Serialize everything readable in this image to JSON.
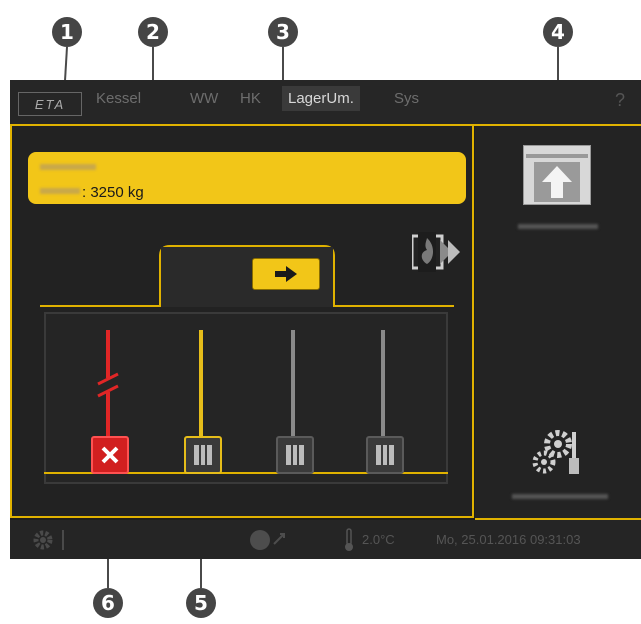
{
  "callouts": [
    {
      "num": "1"
    },
    {
      "num": "2"
    },
    {
      "num": "3"
    },
    {
      "num": "4"
    },
    {
      "num": "5"
    },
    {
      "num": "6"
    }
  ],
  "tabs": [
    {
      "label": "Kessel"
    },
    {
      "label": "WW"
    },
    {
      "label": "HK"
    },
    {
      "label": "LagerUm."
    },
    {
      "label": "Sys"
    }
  ],
  "help_label": "?",
  "logo_text": "ETA",
  "info": {
    "stock_value": ": 3250 kg"
  },
  "status": {
    "temperature": "2.0°C",
    "datetime": "Mo, 25.01.2016 09:31:03"
  },
  "colors": {
    "accent": "#e0b200",
    "panel": "#222222",
    "error": "#e12626",
    "inactive": "#9a9a9a"
  },
  "icons": {
    "transfer": "arrow-right-icon",
    "storage_up": "arrow-up-icon",
    "flame_switch": "flame-icon",
    "settings": "gears-icon",
    "error": "x-icon"
  }
}
